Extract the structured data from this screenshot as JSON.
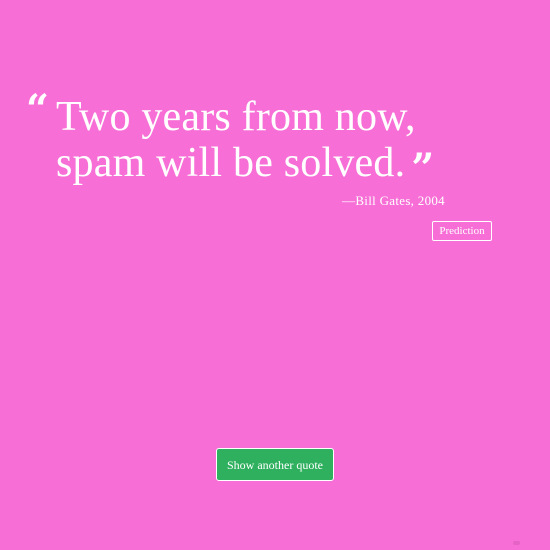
{
  "quote": {
    "open_mark": "“",
    "text": "Two years from now, spam will be solved.",
    "close_mark": "”",
    "attribution": "—Bill Gates, 2004",
    "tag": "Prediction"
  },
  "actions": {
    "next_quote_label": "Show another quote"
  },
  "theme": {
    "background": "#f76fd6",
    "button": "#2fb05f",
    "text": "#ffffff"
  }
}
